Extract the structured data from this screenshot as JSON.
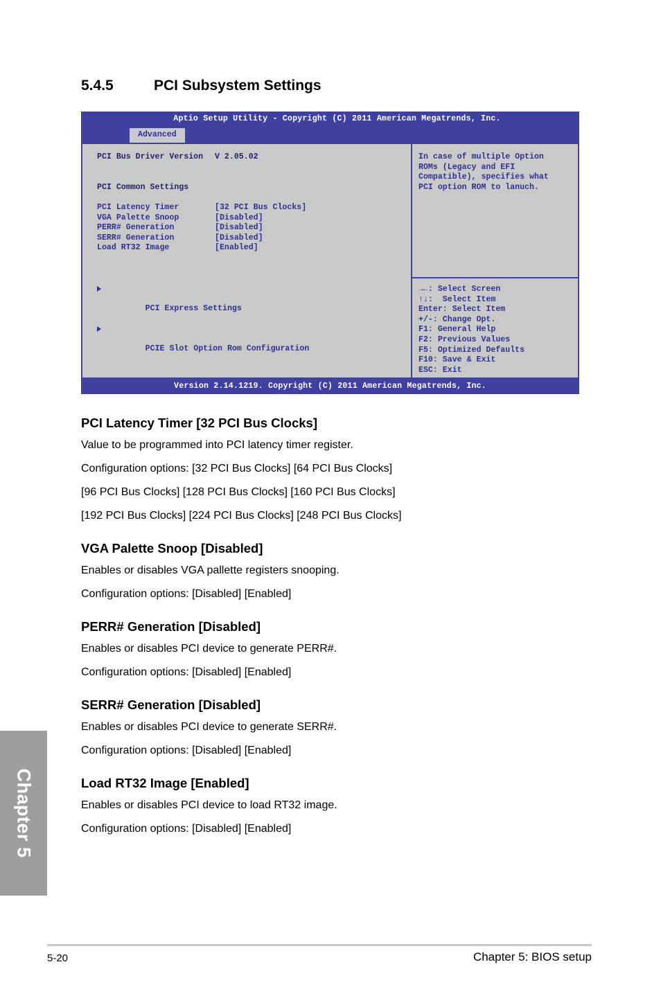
{
  "chapter_tab": {
    "label": "Chapter 5"
  },
  "page_title": {
    "number": "5.4.5",
    "text": "PCI Subsystem Settings"
  },
  "bios": {
    "header_title": "Aptio Setup Utility - Copyright (C) 2011 American Megatrends, Inc.",
    "active_tab": "Advanced",
    "footer": "Version 2.14.1219. Copyright (C) 2011 American Megatrends, Inc.",
    "info_row": {
      "label": "PCI Bus Driver Version",
      "value": "V 2.05.02"
    },
    "section_heading": "PCI Common Settings",
    "settings": [
      {
        "label": "PCI Latency Timer",
        "value": "[32 PCI Bus Clocks]"
      },
      {
        "label": "VGA Palette Snoop",
        "value": "[Disabled]"
      },
      {
        "label": "PERR# Generation",
        "value": "[Disabled]"
      },
      {
        "label": "SERR# Generation",
        "value": "[Disabled]"
      },
      {
        "label": "Load RT32 Image",
        "value": "[Enabled]"
      }
    ],
    "submenus": [
      {
        "label": "PCI Express Settings"
      },
      {
        "label": "PCIE Slot Option Rom Configuration"
      }
    ],
    "help_lines": [
      "In case of multiple Option",
      "ROMs (Legacy and EFI",
      "Compatible), specifies what",
      "PCI option ROM to lanuch."
    ],
    "nav_keys": [
      "→←: Select Screen",
      "↑↓:  Select Item",
      "Enter: Select Item",
      "+/-: Change Opt.",
      "F1: General Help",
      "F2: Previous Values",
      "F5: Optimized Defaults",
      "F10: Save & Exit",
      "ESC: Exit"
    ],
    "colors": {
      "header_bg": "#3f40a0",
      "panel_bg": "#c9c9c9",
      "text_blue": "#2e3191",
      "tab_bg": "#c9c9d2"
    }
  },
  "sections": [
    {
      "heading": "PCI Latency Timer [32 PCI Bus Clocks]",
      "paragraphs": [
        "Value to be programmed into PCI latency timer register.",
        "Configuration options: [32 PCI Bus Clocks] [64 PCI Bus Clocks]",
        "[96 PCI Bus Clocks] [128 PCI Bus Clocks] [160 PCI Bus Clocks]",
        "[192 PCI Bus Clocks] [224 PCI Bus Clocks] [248 PCI Bus Clocks]"
      ]
    },
    {
      "heading": "VGA Palette Snoop [Disabled]",
      "paragraphs": [
        "Enables or disables VGA pallette registers snooping.",
        "Configuration options: [Disabled] [Enabled]"
      ]
    },
    {
      "heading": "PERR# Generation [Disabled]",
      "paragraphs": [
        "Enables or disables PCI device to generate PERR#.",
        "Configuration options: [Disabled] [Enabled]"
      ]
    },
    {
      "heading": "SERR# Generation [Disabled]",
      "paragraphs": [
        "Enables or disables PCI device to generate SERR#.",
        "Configuration options: [Disabled] [Enabled]"
      ]
    },
    {
      "heading": "Load RT32 Image [Enabled]",
      "paragraphs": [
        "Enables or disables PCI device to load RT32 image.",
        "Configuration options: [Disabled] [Enabled]"
      ]
    }
  ],
  "footer": {
    "page_number": "5-20",
    "chapter_label": "Chapter 5: BIOS setup"
  }
}
